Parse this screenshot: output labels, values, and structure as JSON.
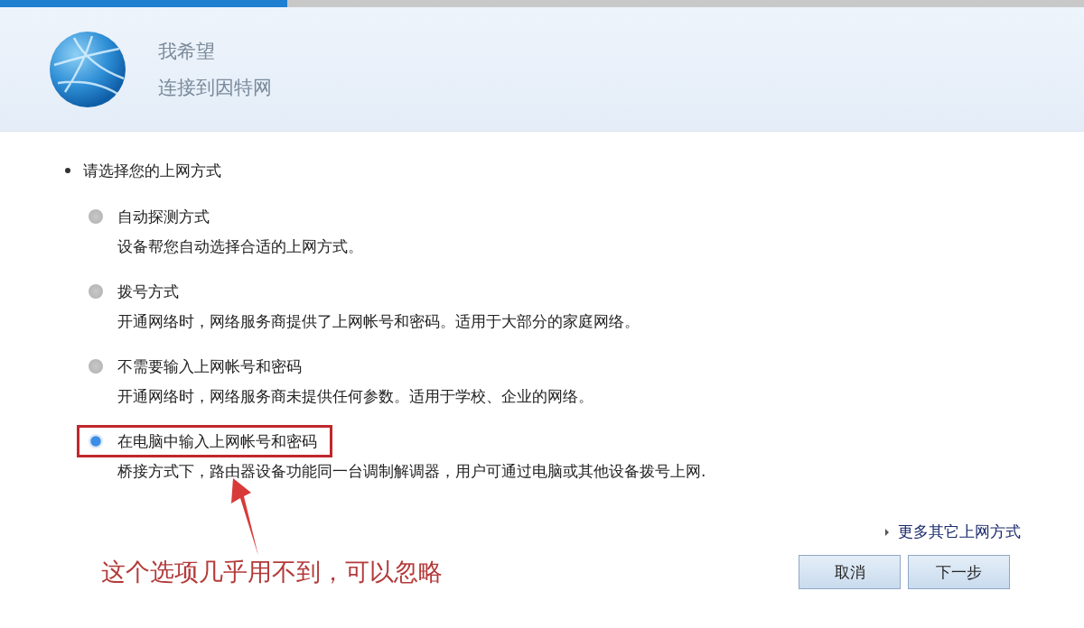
{
  "progress": {
    "level": 0.265
  },
  "header": {
    "line_1": "我希望",
    "line_2": "连接到因特网"
  },
  "prompt": "请选择您的上网方式",
  "options": [
    {
      "label": "自动探测方式",
      "description": "设备帮您自动选择合适的上网方式。",
      "selected": false,
      "highlighted": false
    },
    {
      "label": "拨号方式",
      "description": "开通网络时，网络服务商提供了上网帐号和密码。适用于大部分的家庭网络。",
      "selected": false,
      "highlighted": false
    },
    {
      "label": "不需要输入上网帐号和密码",
      "description": "开通网络时，网络服务商未提供任何参数。适用于学校、企业的网络。",
      "selected": false,
      "highlighted": false
    },
    {
      "label": "在电脑中输入上网帐号和密码",
      "description": "桥接方式下，路由器设备功能同一台调制解调器，用户可通过电脑或其他设备拨号上网.",
      "selected": true,
      "highlighted": true
    }
  ],
  "more_link": "更多其它上网方式",
  "annotation": "这个选项几乎用不到，可以忽略",
  "buttons": [
    "取消",
    "下一步"
  ]
}
